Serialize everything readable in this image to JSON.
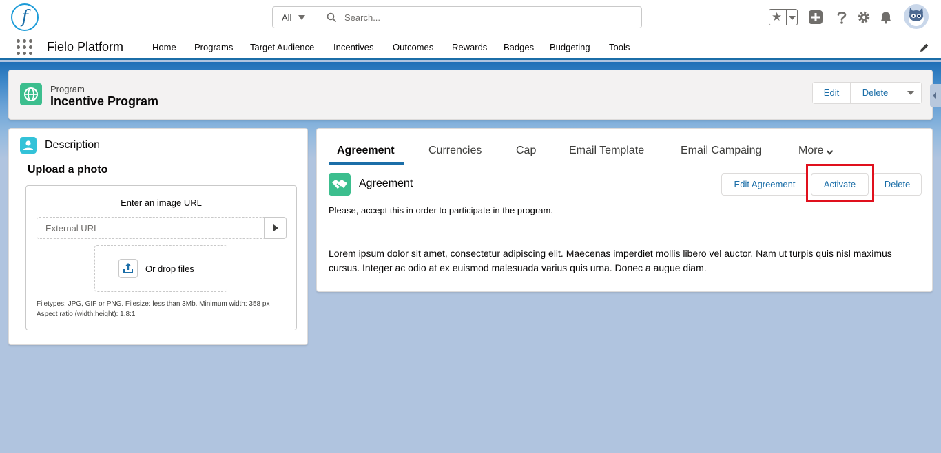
{
  "header": {
    "logo_letter": "f",
    "search_scope": "All",
    "search_placeholder": "Search..."
  },
  "nav": {
    "app_name": "Fielo Platform",
    "items": [
      "Home",
      "Programs",
      "Target Audience",
      "Incentives",
      "Outcomes",
      "Rewards",
      "Badges",
      "Budgeting",
      "Tools"
    ]
  },
  "record": {
    "object_label": "Program",
    "title": "Incentive Program",
    "actions": [
      "Edit",
      "Delete"
    ]
  },
  "description_card": {
    "title": "Description",
    "upload_title": "Upload a photo",
    "url_label": "Enter an image URL",
    "url_placeholder": "External URL",
    "drop_label": "Or drop files",
    "help_line1": "Filetypes: JPG, GIF or PNG. Filesize: less than 3Mb. Minimum width: 358 px",
    "help_line2": "Aspect ratio (width:height): 1.8:1"
  },
  "agreement_card": {
    "tabs": [
      "Agreement",
      "Currencies",
      "Cap",
      "Email Template",
      "Email Campaing",
      "More"
    ],
    "active_tab": "Agreement",
    "section_title": "Agreement",
    "buttons": [
      "Edit Agreement",
      "Activate",
      "Delete"
    ],
    "highlighted_button": "Activate",
    "text1": "Please, accept this in order to participate in the program.",
    "text2": "Lorem ipsum dolor sit amet, consectetur adipiscing elit. Maecenas imperdiet mollis libero vel auctor. Nam ut turpis quis nisl maximus cursus. Integer ac odio at ex euismod malesuada varius quis urna. Donec a augue diam."
  },
  "colors": {
    "brand_blue": "#1b6ea8",
    "program_icon": "#3cbe8e",
    "contact_icon": "#33c2d8",
    "highlight": "#e0101d"
  },
  "icons": [
    "search-icon",
    "star-icon",
    "plus-icon",
    "help-icon",
    "gear-icon",
    "bell-icon",
    "avatar-icon",
    "app-launcher-icon",
    "pencil-icon",
    "globe-icon",
    "contact-icon",
    "upload-icon",
    "handshake-icon",
    "chevron-down-icon"
  ]
}
